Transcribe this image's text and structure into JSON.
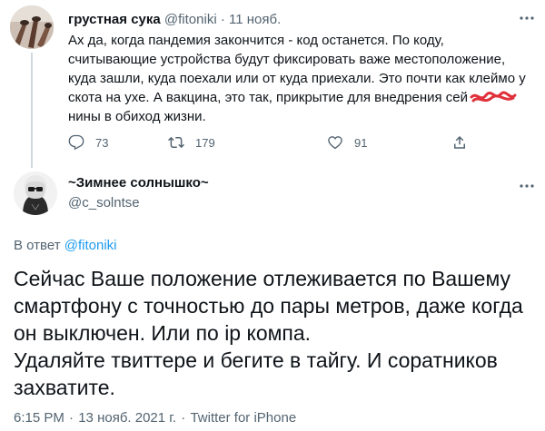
{
  "parent_tweet": {
    "display_name": "грустная сука",
    "handle": "@fitoniki",
    "separator": "·",
    "date": "11 нояб.",
    "text_before_scribble": "Ах да, когда пандемия закончится - код останется. По коду, считывающие устройства будут фиксировать важе местоположение, куда зашли, куда поехали или от куда приехали. Это почти как клеймо у скота на ухе. А вакцина, это так, прикрытие для внедрения сей ",
    "text_after_scribble": "нины в обиход жизни.",
    "replies": "73",
    "retweets": "179",
    "likes": "91",
    "colors": {
      "scribble": "#e0303a",
      "muted": "#536471"
    }
  },
  "main_tweet": {
    "display_name": "~Зимнее солнышко~",
    "handle": "@c_solntse",
    "reply_prefix": "В ответ",
    "reply_handle": "@fitoniki",
    "text_lines": [
      "Сейчас Ваше положение отлеживается по Вашему",
      "смартфону с точностью до пары метров, даже когда",
      "он выключен. Или по ip компа.",
      "Удаляйте твиттере и бегите в тайгу. И соратников",
      "захватите."
    ],
    "time": "6:15 PM",
    "separator": "·",
    "date": "13 нояб. 2021 г.",
    "source": "Twitter for iPhone",
    "colors": {
      "link": "#1d9bf0"
    }
  },
  "icons": [
    "more-icon",
    "reply-icon",
    "retweet-icon",
    "like-icon",
    "share-icon"
  ]
}
